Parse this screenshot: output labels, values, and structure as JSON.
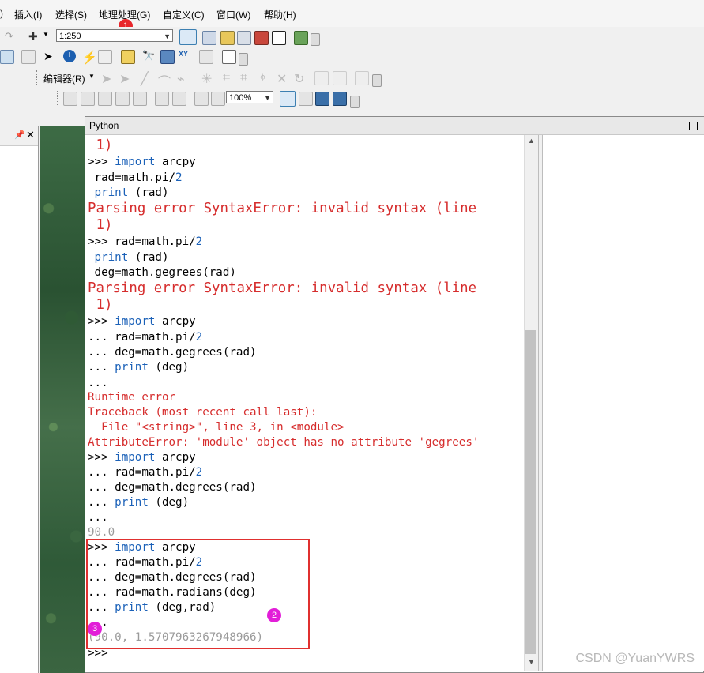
{
  "menu": {
    "insert": "插入(I)",
    "select": "选择(S)",
    "geoprocessing": "地理处理(G)",
    "customize": "自定义(C)",
    "window": "窗口(W)",
    "help": "帮助(H)"
  },
  "toolbar": {
    "scale_value": "1:250",
    "editor_label": "编辑器(R)",
    "zoom_value": "100%"
  },
  "python_window": {
    "title": "Python",
    "lines": [
      {
        "prompt": " 1)",
        "code": "",
        "type": "err-big"
      },
      {
        "prompt": ">>> ",
        "kw": "import",
        "rest": " arcpy",
        "type": "code"
      },
      {
        "prompt": " ",
        "code": "rad=math.pi/",
        "num": "2",
        "type": "code"
      },
      {
        "prompt": " ",
        "kw": "print",
        "rest": " (rad)",
        "type": "code"
      },
      {
        "prompt": "Parsing error SyntaxError: invalid syntax (line",
        "type": "err-big"
      },
      {
        "prompt": " 1)",
        "type": "err-big"
      },
      {
        "prompt": ">>> ",
        "code": "rad=math.pi/",
        "num": "2",
        "type": "code"
      },
      {
        "prompt": " ",
        "kw": "print",
        "rest": " (rad)",
        "type": "code"
      },
      {
        "prompt": " ",
        "code": "deg=math.gegrees(rad)",
        "type": "code"
      },
      {
        "prompt": "Parsing error SyntaxError: invalid syntax (line",
        "type": "err-big"
      },
      {
        "prompt": " 1)",
        "type": "err-big"
      },
      {
        "prompt": ">>> ",
        "kw": "import",
        "rest": " arcpy",
        "type": "code"
      },
      {
        "prompt": "... ",
        "code": "rad=math.pi/",
        "num": "2",
        "type": "code"
      },
      {
        "prompt": "... ",
        "code": "deg=math.gegrees(rad)",
        "type": "code"
      },
      {
        "prompt": "... ",
        "kw": "print",
        "rest": " (deg)",
        "type": "code"
      },
      {
        "prompt": "...",
        "type": "code"
      },
      {
        "prompt": "Runtime error",
        "type": "err"
      },
      {
        "prompt": "Traceback (most recent call last):",
        "type": "err"
      },
      {
        "prompt": "  File \"<string>\", line 3, in <module>",
        "type": "err"
      },
      {
        "prompt": "AttributeError: 'module' object has no attribute 'gegrees'",
        "type": "err"
      },
      {
        "prompt": ">>> ",
        "kw": "import",
        "rest": " arcpy",
        "type": "code"
      },
      {
        "prompt": "... ",
        "code": "rad=math.pi/",
        "num": "2",
        "type": "code"
      },
      {
        "prompt": "... ",
        "code": "deg=math.degrees(rad)",
        "type": "code"
      },
      {
        "prompt": "... ",
        "kw": "print",
        "rest": " (deg)",
        "type": "code"
      },
      {
        "prompt": "...",
        "type": "code"
      },
      {
        "prompt": "90.0",
        "type": "out"
      },
      {
        "prompt": ">>> ",
        "kw": "import",
        "rest": " arcpy",
        "type": "code"
      },
      {
        "prompt": "... ",
        "code": "rad=math.pi/",
        "num": "2",
        "type": "code"
      },
      {
        "prompt": "... ",
        "code": "deg=math.degrees(rad)",
        "type": "code"
      },
      {
        "prompt": "... ",
        "code": "rad=math.radians(deg)",
        "type": "code"
      },
      {
        "prompt": "... ",
        "kw": "print",
        "rest": " (deg,rad)",
        "type": "code"
      },
      {
        "prompt": "...",
        "type": "code"
      },
      {
        "prompt": "(90.0, 1.5707963267948966)",
        "type": "out"
      },
      {
        "prompt": ">>>",
        "type": "code"
      }
    ]
  },
  "annotations": {
    "badge1": "1",
    "badge2": "2",
    "badge3": "3",
    "badge1_color": "#e8262b",
    "badge2_color": "#e21ed8",
    "badge3_color": "#e21ed8"
  },
  "watermark": "CSDN @YuanYWRS"
}
